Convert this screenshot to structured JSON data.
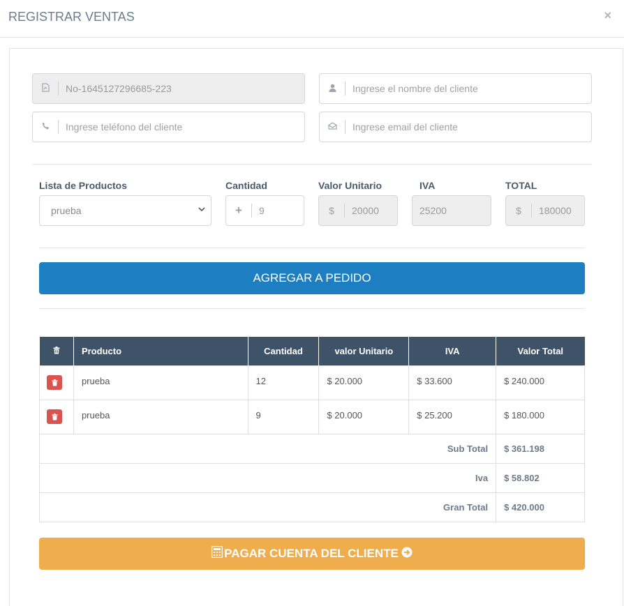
{
  "modal": {
    "title": "REGISTRAR VENTAS",
    "close": "×"
  },
  "form": {
    "invoice_code": "No-1645127296685-223",
    "client_name_placeholder": "Ingrese el nombre del cliente",
    "phone_placeholder": "Ingrese teléfono del cliente",
    "email_placeholder": "Ingrese email del cliente"
  },
  "product": {
    "list_label": "Lista de Productos",
    "qty_label": "Cantidad",
    "unit_label": "Valor Unitario",
    "iva_label": "IVA",
    "total_label": "TOTAL",
    "selected": "prueba",
    "qty": "9",
    "unit_value": "20000",
    "iva_value": "25200",
    "total_value": "180000",
    "currency": "$",
    "plus": "+"
  },
  "add_button": "AGREGAR A PEDIDO",
  "table": {
    "headers": [
      "Producto",
      "Cantidad",
      "valor Unitario",
      "IVA",
      "Valor Total"
    ],
    "rows": [
      {
        "product": "prueba",
        "qty": "12",
        "unit": "$ 20.000",
        "iva": "$ 33.600",
        "total": "$ 240.000"
      },
      {
        "product": "prueba",
        "qty": "9",
        "unit": "$ 20.000",
        "iva": "$ 25.200",
        "total": "$ 180.000"
      }
    ],
    "totals": {
      "subtotal_label": "Sub Total",
      "subtotal": "$ 361.198",
      "iva_label": "Iva",
      "iva": "$ 58.802",
      "grand_label": "Gran Total",
      "grand": "$ 420.000"
    }
  },
  "pay_button": "PAGAR CUENTA DEL CLIENTE",
  "colors": {
    "primary": "#1d7ec2",
    "warning": "#f0ad4e",
    "danger": "#d9534f",
    "table_header": "#3e5268"
  }
}
